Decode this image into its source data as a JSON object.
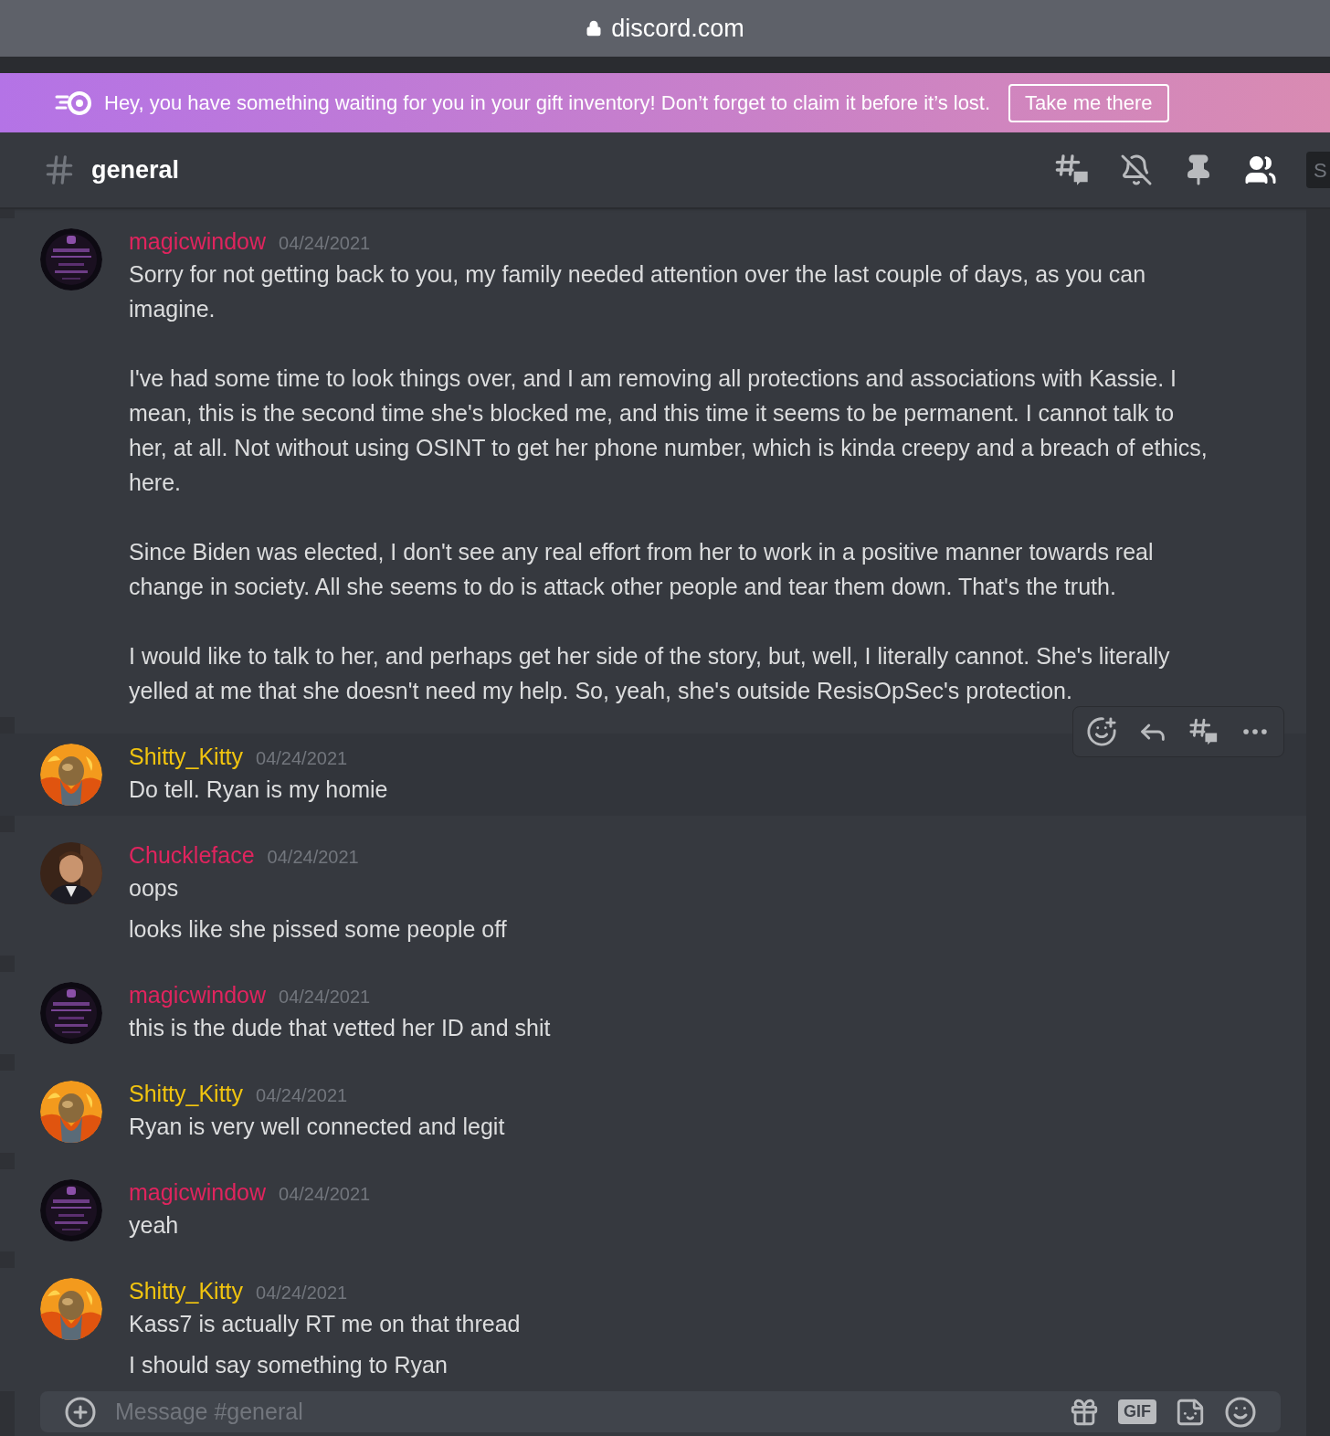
{
  "browser": {
    "url": "discord.com"
  },
  "banner": {
    "text": "Hey, you have something waiting for you in your gift inventory! Don’t forget to claim it before it’s lost.",
    "button": "Take me there"
  },
  "channel": {
    "name": "general",
    "search_placeholder": "S"
  },
  "messages": [
    {
      "author": "magicwindow",
      "color": "#e0245e",
      "time": "04/24/2021",
      "hovered": false,
      "paragraphs": [
        "Sorry for not getting back to you, my family needed attention over the last couple of days, as you can imagine.",
        "I've had some time to look things over, and I am removing all protections and associations with Kassie. I mean, this is the second time she's blocked me, and this time it seems to be permanent. I cannot talk to her, at all. Not without using OSINT to get her phone number, which is kinda creepy and a breach of ethics, here.",
        "Since Biden was elected, I don't see any real effort from her to work in a positive manner towards real change in society. All she seems to do is attack other people and tear them down. That's the truth.",
        "I would like to talk to her, and perhaps get her side of the story, but, well, I literally cannot. She's literally yelled at me that she doesn't need my help. So, yeah, she's outside ResisOpSec's protection."
      ]
    },
    {
      "author": "Shitty_Kitty",
      "color": "#f1c40f",
      "time": "04/24/2021",
      "hovered": true,
      "paragraphs": [
        "Do tell. Ryan is my homie"
      ]
    },
    {
      "author": "Chuckleface",
      "color": "#e0245e",
      "time": "04/24/2021",
      "hovered": false,
      "paragraphs": [
        "oops",
        "looks like she pissed some people off"
      ]
    },
    {
      "author": "magicwindow",
      "color": "#e0245e",
      "time": "04/24/2021",
      "hovered": false,
      "paragraphs": [
        "this is the dude that vetted her ID and shit"
      ]
    },
    {
      "author": "Shitty_Kitty",
      "color": "#f1c40f",
      "time": "04/24/2021",
      "hovered": false,
      "paragraphs": [
        "Ryan is very well connected and legit"
      ]
    },
    {
      "author": "magicwindow",
      "color": "#e0245e",
      "time": "04/24/2021",
      "hovered": false,
      "paragraphs": [
        "yeah"
      ]
    },
    {
      "author": "Shitty_Kitty",
      "color": "#f1c40f",
      "time": "04/24/2021",
      "hovered": false,
      "paragraphs": [
        "Kass7 is actually RT me on that thread",
        "I should say something to Ryan"
      ]
    }
  ],
  "composer": {
    "placeholder": "Message #general",
    "gif_label": "GIF"
  }
}
